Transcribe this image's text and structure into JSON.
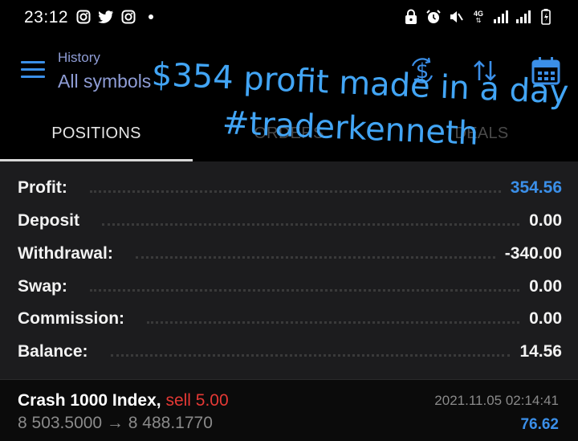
{
  "status_bar": {
    "time": "23:12",
    "left_icons": [
      "instagram-icon",
      "twitter-icon",
      "instagram-icon",
      "notification-dot-icon"
    ],
    "right_icons": [
      "lock-icon",
      "alarm-icon",
      "mute-icon",
      "4g-icon",
      "signal-icon",
      "signal-icon",
      "battery-icon"
    ],
    "network_label": "4G"
  },
  "toolbar": {
    "subtitle": "History",
    "title": "All symbols",
    "icons": [
      "currency-icon",
      "sort-icon",
      "calendar-icon"
    ]
  },
  "tabs": [
    {
      "label": "POSITIONS",
      "active": true
    },
    {
      "label": "ORDERS",
      "active": false
    },
    {
      "label": "DEALS",
      "active": false
    }
  ],
  "overlay": {
    "line1": "$354 profit made in a day",
    "line2": "#traderkenneth"
  },
  "summary": [
    {
      "label": "Profit:",
      "value": "354.56",
      "highlight": true
    },
    {
      "label": "Deposit",
      "value": "0.00",
      "highlight": false
    },
    {
      "label": "Withdrawal:",
      "value": "-340.00",
      "highlight": false
    },
    {
      "label": "Swap:",
      "value": "0.00",
      "highlight": false
    },
    {
      "label": "Commission:",
      "value": "0.00",
      "highlight": false
    },
    {
      "label": "Balance:",
      "value": "14.56",
      "highlight": false
    }
  ],
  "position": {
    "symbol": "Crash 1000 Index,",
    "side": "sell 5.00",
    "prices": "8 503.5000 → 8 488.1770",
    "time": "2021.11.05 02:14:41",
    "profit": "76.62"
  },
  "colors": {
    "accent": "#3b8fe8",
    "sell": "#e53935",
    "overlay_text": "#42a5f5",
    "panel_bg": "#1c1c1e",
    "title": "#8f9dd6"
  }
}
